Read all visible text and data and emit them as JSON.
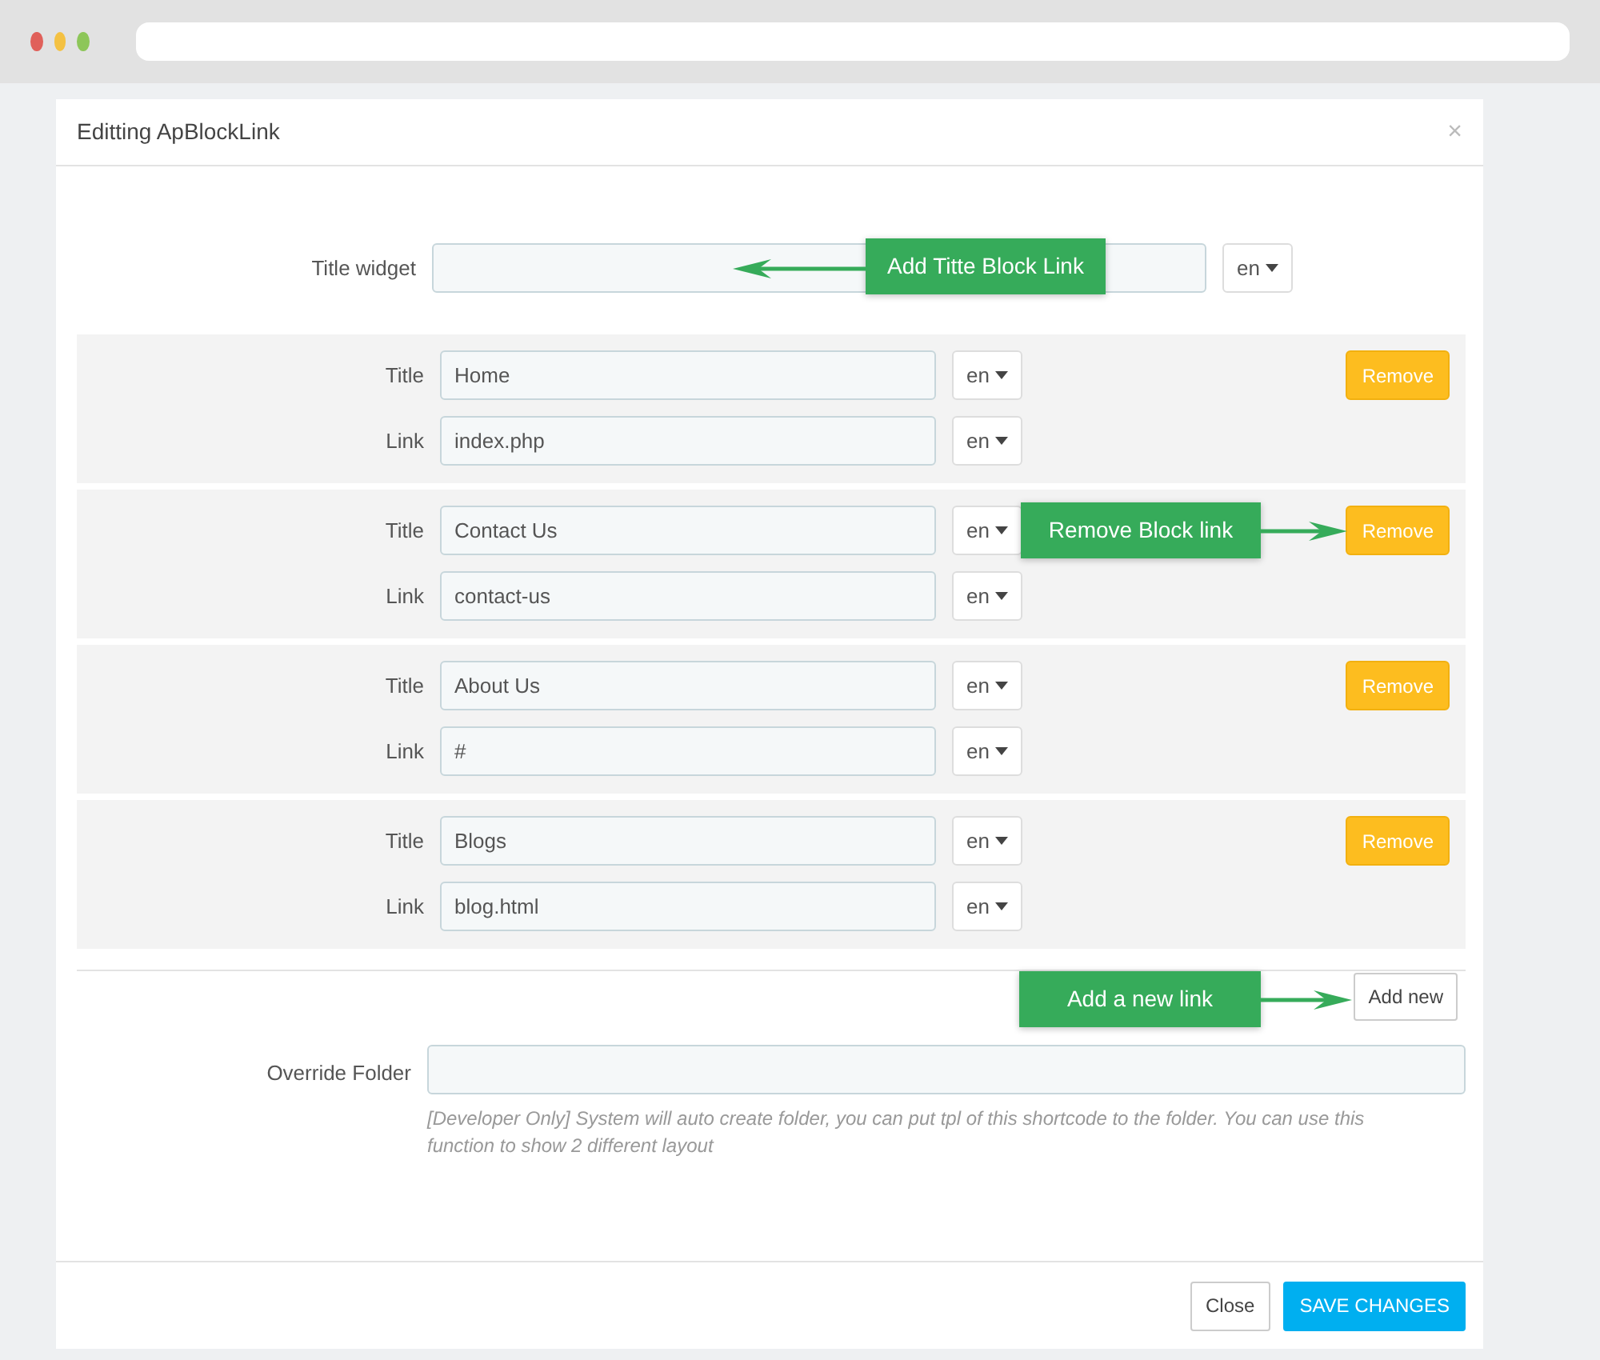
{
  "modal": {
    "title": "Editting ApBlockLink",
    "close_icon": "×"
  },
  "title_widget": {
    "label": "Title widget",
    "lang": "en",
    "callout": {
      "text": "Add Titte Block Link"
    }
  },
  "link_blocks": [
    {
      "title_label": "Title",
      "title_value": "Home",
      "title_lang": "en",
      "link_label": "Link",
      "link_value": "index.php",
      "link_lang": "en",
      "remove": "Remove"
    },
    {
      "title_label": "Title",
      "title_value": "Contact Us",
      "title_lang": "en",
      "link_label": "Link",
      "link_value": "contact-us",
      "link_lang": "en",
      "remove": "Remove",
      "callout": {
        "text": "Remove Block link"
      }
    },
    {
      "title_label": "Title",
      "title_value": "About Us",
      "title_lang": "en",
      "link_label": "Link",
      "link_value": "#",
      "link_lang": "en",
      "remove": "Remove"
    },
    {
      "title_label": "Title",
      "title_value": "Blogs",
      "title_lang": "en",
      "link_label": "Link",
      "link_value": "blog.html",
      "link_lang": "en",
      "remove": "Remove"
    }
  ],
  "add_new": {
    "label": "Add new",
    "callout": {
      "text": "Add a new link"
    }
  },
  "override_folder": {
    "label": "Override Folder",
    "help": "[Developer Only] System will auto create folder, you can put tpl of this shortcode to the folder. You can use this function to show 2 different layout"
  },
  "footer": {
    "buttons": [
      {
        "label": "Close",
        "kind": "secondary"
      },
      {
        "label": "SAVE CHANGES",
        "kind": "primary"
      }
    ]
  }
}
